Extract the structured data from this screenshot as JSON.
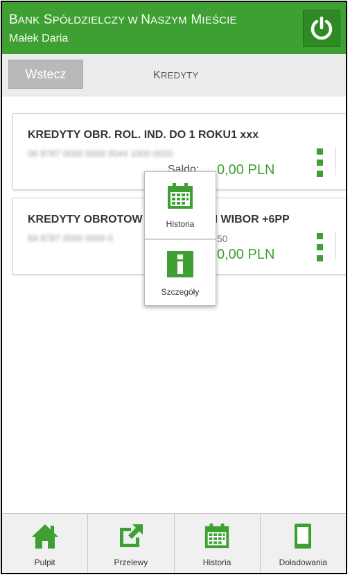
{
  "header": {
    "bank_name_B": "B",
    "bank_name_ANK": "ANK",
    "bank_name_S": " S",
    "bank_name_POLDZIELCZY": "PÓŁDZIELCZY",
    "bank_name_W": " W ",
    "bank_name_N": "N",
    "bank_name_ASZYM": "ASZYM",
    "bank_name_M": " M",
    "bank_name_IESCIE": "IEŚCIE",
    "user_name": "Małek Daria",
    "power_icon": "power-icon"
  },
  "toolbar": {
    "back_label": "Wstecz",
    "title_K": "K",
    "title_REDYTY": "REDYTY"
  },
  "accounts": [
    {
      "title": "KREDYTY OBR. ROL. IND. DO 1 ROKU1 xxx",
      "account_number": "06 8787 0000 0000 0044 1000 0020",
      "saldo_label": "Saldo:",
      "amount": "0,00 PLN"
    },
    {
      "title_left": "KREDYTY OBROTOW",
      "title_right": "WIBOR +6PP",
      "title_mid_char": "I",
      "account_number_left": "69 8787 0000 0000 0",
      "account_number_right": "50",
      "amount": "0,00 PLN"
    }
  ],
  "popup": {
    "items": [
      {
        "label": "Historia",
        "icon": "calendar-icon"
      },
      {
        "label": "Szczegóły",
        "icon": "info-icon"
      }
    ]
  },
  "bottom_nav": {
    "items": [
      {
        "label": "Pulpit",
        "icon": "home-icon"
      },
      {
        "label": "Przelewy",
        "icon": "transfer-icon"
      },
      {
        "label": "Historia",
        "icon": "calendar-icon"
      },
      {
        "label": "Doładowania",
        "icon": "phone-icon"
      }
    ]
  },
  "colors": {
    "brand_green": "#3ea032",
    "toolbar_bg": "#ececec"
  }
}
